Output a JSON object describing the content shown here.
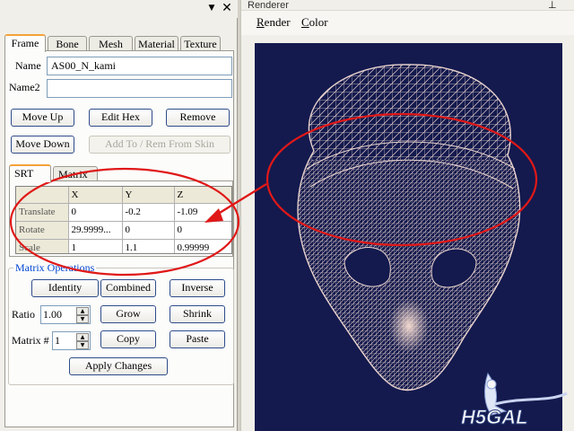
{
  "panel": {
    "dropdown_icon": "▼",
    "close_icon": "✕"
  },
  "tabs": [
    "Frame",
    "Bone",
    "Mesh",
    "Material",
    "Texture"
  ],
  "frame": {
    "name_label": "Name",
    "name_value": "AS00_N_kami",
    "name2_label": "Name2",
    "name2_value": "",
    "buttons": {
      "move_up": "Move Up",
      "edit_hex": "Edit Hex",
      "remove": "Remove",
      "move_down": "Move Down",
      "add_to_skin": "Add To / Rem From Skin"
    }
  },
  "srt": {
    "tabs": [
      "SRT",
      "Matrix"
    ],
    "columns": [
      "",
      "X",
      "Y",
      "Z"
    ],
    "rows": [
      {
        "label": "Translate",
        "x": "0",
        "y": "-0.2",
        "z": "-1.09"
      },
      {
        "label": "Rotate",
        "x": "29.9999...",
        "y": "0",
        "z": "0"
      },
      {
        "label": "Scale",
        "x": "1",
        "y": "1.1",
        "z": "0.99999"
      }
    ]
  },
  "matrix_ops": {
    "title": "Matrix Operations",
    "identity": "Identity",
    "combined": "Combined",
    "inverse": "Inverse",
    "ratio_label": "Ratio",
    "ratio_value": "1.00",
    "grow": "Grow",
    "shrink": "Shrink",
    "matrix_label": "Matrix #",
    "matrix_value": "1",
    "copy": "Copy",
    "paste": "Paste",
    "apply": "Apply Changes"
  },
  "renderer": {
    "title": "Renderer",
    "pin_icon": "📌",
    "menu": [
      {
        "label": "Render",
        "mnemonic": "R"
      },
      {
        "label": "Color",
        "mnemonic": "C"
      }
    ]
  },
  "watermark": {
    "text": "H5GAL"
  },
  "colors": {
    "viewport_bg": "#141a4e",
    "mesh": "#e9d3ce",
    "annotation": "#e01818",
    "tab_highlight": "#f4a23a"
  }
}
